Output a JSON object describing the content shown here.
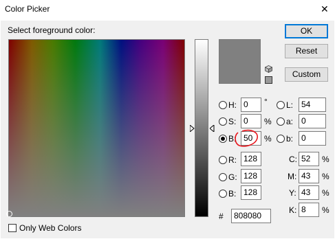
{
  "window": {
    "title": "Color Picker",
    "close_glyph": "✕"
  },
  "picker": {
    "label": "Select foreground color:"
  },
  "buttons": {
    "ok": "OK",
    "cancel": "Reset",
    "custom": "Custom"
  },
  "swatch": {
    "current_color": "#808080"
  },
  "hsb": [
    {
      "label": "H:",
      "value": "0",
      "unit": "°",
      "selected": false
    },
    {
      "label": "S:",
      "value": "0",
      "unit": "%",
      "selected": false
    },
    {
      "label": "B:",
      "value": "50",
      "unit": "%",
      "selected": true
    }
  ],
  "rgb": [
    {
      "label": "R:",
      "value": "128"
    },
    {
      "label": "G:",
      "value": "128"
    },
    {
      "label": "B:",
      "value": "128"
    }
  ],
  "lab": [
    {
      "label": "L:",
      "value": "54"
    },
    {
      "label": "a:",
      "value": "0"
    },
    {
      "label": "b:",
      "value": "0"
    }
  ],
  "cmyk": [
    {
      "label": "C:",
      "value": "52",
      "unit": "%"
    },
    {
      "label": "M:",
      "value": "43",
      "unit": "%"
    },
    {
      "label": "Y:",
      "value": "43",
      "unit": "%"
    },
    {
      "label": "K:",
      "value": "8",
      "unit": "%"
    }
  ],
  "hex": {
    "label": "#",
    "value": "808080"
  },
  "web_only": {
    "label": "Only Web Colors",
    "checked": false
  },
  "icons": {
    "cube": "cube-icon",
    "web_swatch": "web-swatch-icon"
  },
  "annotation_color": "#e8141b"
}
